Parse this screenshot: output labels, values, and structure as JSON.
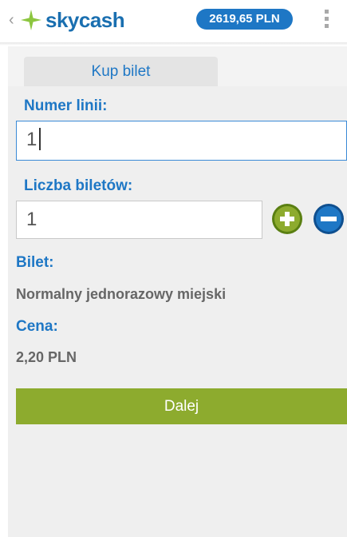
{
  "header": {
    "back_glyph": "‹",
    "logo_text": "skycash",
    "balance": "2619,65 PLN"
  },
  "tabs": [
    {
      "label": "Kup bilet",
      "active": true
    }
  ],
  "form": {
    "line_number": {
      "label": "Numer linii:",
      "value": "1"
    },
    "ticket_count": {
      "label": "Liczba biletów:",
      "value": "1"
    },
    "ticket": {
      "label": "Bilet:",
      "value": "Normalny jednorazowy miejski"
    },
    "price": {
      "label": "Cena:",
      "value": "2,20 PLN"
    },
    "submit_label": "Dalej"
  },
  "colors": {
    "brand_blue": "#1e77c5",
    "logo_green": "#8cc63f",
    "button_green": "#8dab2e",
    "minus_blue": "#1e77c5"
  }
}
